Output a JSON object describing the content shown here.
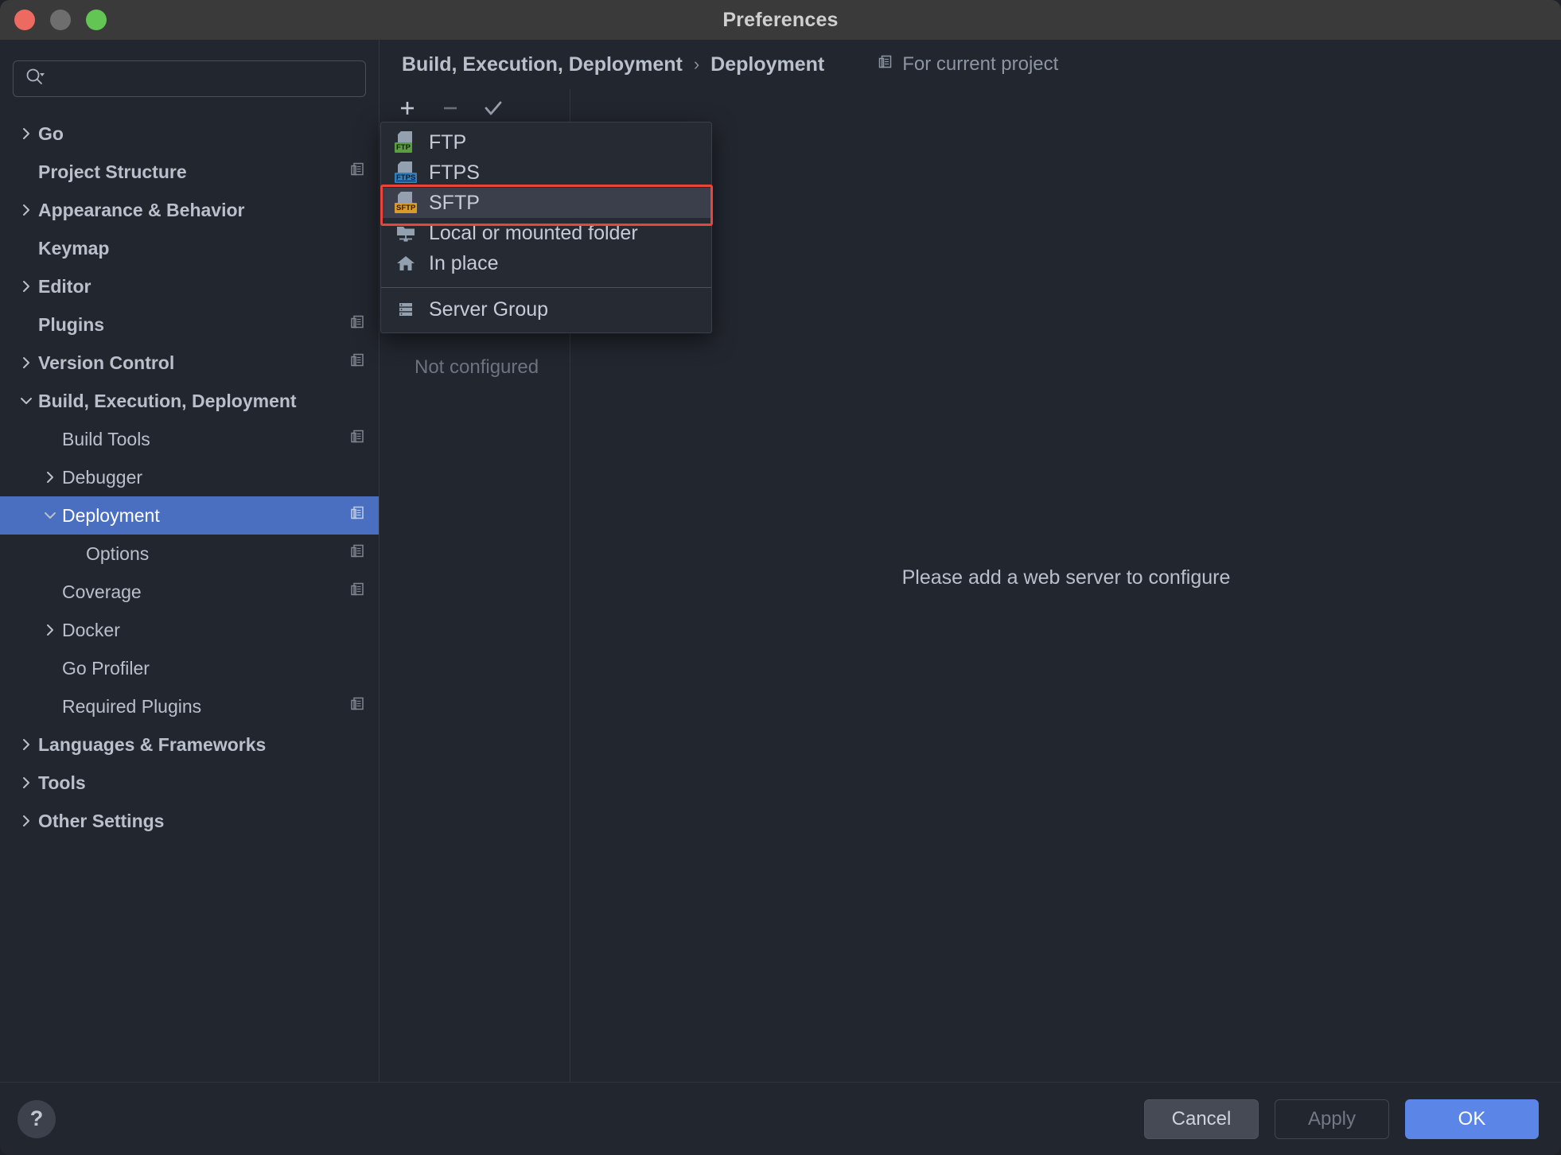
{
  "window": {
    "title": "Preferences",
    "traffic_lights": [
      "close",
      "minimize",
      "zoom"
    ]
  },
  "sidebar": {
    "search": {
      "value": "",
      "placeholder": ""
    },
    "items": [
      {
        "label": "Go",
        "level": 0,
        "chevron": "right",
        "copy": false,
        "selected": false
      },
      {
        "label": "Project Structure",
        "level": 0,
        "chevron": "none",
        "copy": true,
        "selected": false
      },
      {
        "label": "Appearance & Behavior",
        "level": 0,
        "chevron": "right",
        "copy": false,
        "selected": false
      },
      {
        "label": "Keymap",
        "level": 0,
        "chevron": "none",
        "copy": false,
        "selected": false
      },
      {
        "label": "Editor",
        "level": 0,
        "chevron": "right",
        "copy": false,
        "selected": false
      },
      {
        "label": "Plugins",
        "level": 0,
        "chevron": "none",
        "copy": true,
        "selected": false
      },
      {
        "label": "Version Control",
        "level": 0,
        "chevron": "right",
        "copy": true,
        "selected": false
      },
      {
        "label": "Build, Execution, Deployment",
        "level": 0,
        "chevron": "down",
        "copy": false,
        "selected": false
      },
      {
        "label": "Build Tools",
        "level": 1,
        "chevron": "none",
        "copy": true,
        "selected": false
      },
      {
        "label": "Debugger",
        "level": 1,
        "chevron": "right",
        "copy": false,
        "selected": false
      },
      {
        "label": "Deployment",
        "level": 1,
        "chevron": "down",
        "copy": true,
        "selected": true
      },
      {
        "label": "Options",
        "level": 2,
        "chevron": "none",
        "copy": true,
        "selected": false
      },
      {
        "label": "Coverage",
        "level": 1,
        "chevron": "none",
        "copy": true,
        "selected": false
      },
      {
        "label": "Docker",
        "level": 1,
        "chevron": "right",
        "copy": false,
        "selected": false
      },
      {
        "label": "Go Profiler",
        "level": 1,
        "chevron": "none",
        "copy": false,
        "selected": false
      },
      {
        "label": "Required Plugins",
        "level": 1,
        "chevron": "none",
        "copy": true,
        "selected": false
      },
      {
        "label": "Languages & Frameworks",
        "level": 0,
        "chevron": "right",
        "copy": false,
        "selected": false
      },
      {
        "label": "Tools",
        "level": 0,
        "chevron": "right",
        "copy": false,
        "selected": false
      },
      {
        "label": "Other Settings",
        "level": 0,
        "chevron": "right",
        "copy": false,
        "selected": false
      }
    ]
  },
  "header": {
    "breadcrumb_root": "Build, Execution, Deployment",
    "breadcrumb_sep": "›",
    "breadcrumb_leaf": "Deployment",
    "scope_label": "For current project"
  },
  "toolbar": {
    "add_label": "+",
    "remove_label": "−",
    "check_label": "✓"
  },
  "middle": {
    "empty_text": "Not configured"
  },
  "detail": {
    "message": "Please add a web server to configure"
  },
  "popup": {
    "items": [
      {
        "label": "FTP",
        "icon": "ftp-doc-icon"
      },
      {
        "label": "FTPS",
        "icon": "ftps-doc-icon"
      },
      {
        "label": "SFTP",
        "icon": "sftp-doc-icon",
        "highlighted": true
      },
      {
        "label": "Local or mounted folder",
        "icon": "mounted-folder-icon"
      },
      {
        "label": "In place",
        "icon": "home-icon"
      }
    ],
    "group_item": {
      "label": "Server Group",
      "icon": "server-stack-icon"
    },
    "annotation_color": "#e8453c"
  },
  "footer": {
    "help_label": "?",
    "cancel_label": "Cancel",
    "apply_label": "Apply",
    "ok_label": "OK"
  },
  "colors": {
    "accent": "#5b86e8",
    "selection": "#4a6fc0",
    "annotation": "#e8453c",
    "ftp_tag": "#5a9e3f",
    "ftps_tag": "#2f7fbf",
    "sftp_tag": "#d99c2b"
  }
}
